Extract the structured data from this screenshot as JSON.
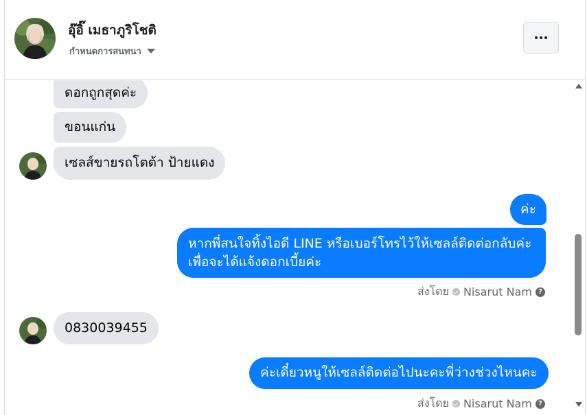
{
  "header": {
    "contact_name": "อุ๊อิ๊ เมธาภูริโชติ",
    "subtitle": "กำหนดการสนทนา",
    "more_button": "more-options"
  },
  "messages": [
    {
      "direction": "in",
      "text": "ดอกถูกสุดค่ะ"
    },
    {
      "direction": "in",
      "text": "ขอนแก่น"
    },
    {
      "direction": "in",
      "text": "เซลส์ขายรถโตต้า ป้ายแดง"
    },
    {
      "direction": "out",
      "text": "ค่ะ"
    },
    {
      "direction": "out",
      "line1": "หากพี่สนใจทิ้งไอดี LINE หรือเบอร์โทรไว้ให้เซลล์ติดต่อกลับค่ะ",
      "line2": "เพื่อจะได้แจ้งดอกเบี้ยค่ะ"
    },
    {
      "direction": "in",
      "text": "0830039455"
    },
    {
      "direction": "out",
      "text": "ค่ะเดี๋ยวหนูให้เซลล์ติดต่อไปนะคะพี่ว่างช่วงไหนคะ"
    }
  ],
  "sent_by": {
    "label": "ส่งโดย",
    "sender": "Nisarut Nam"
  },
  "colors": {
    "outgoing_bubble": "#0a7cff",
    "incoming_bubble": "#e4e6eb"
  }
}
